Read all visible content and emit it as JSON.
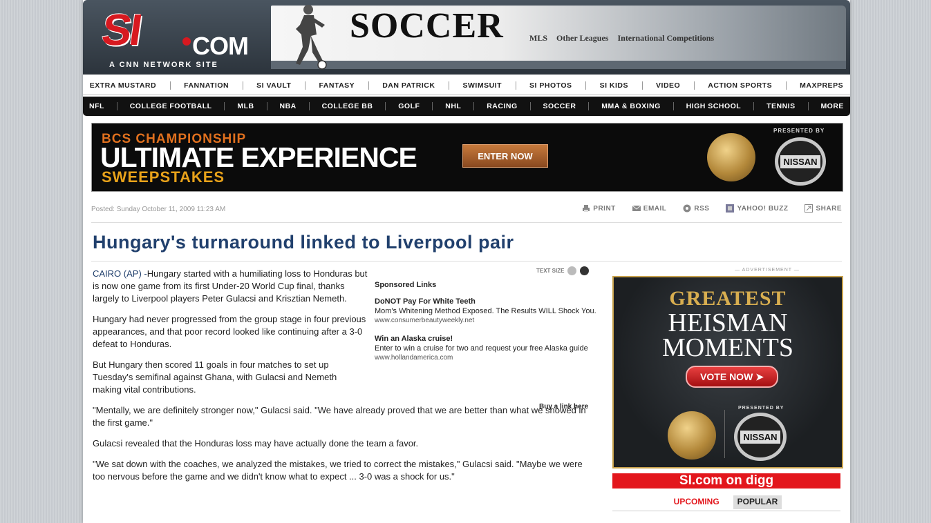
{
  "header": {
    "logo_si": "SI",
    "logo_com": "COM",
    "logo_tagline": "A CNN NETWORK SITE",
    "section_title": "SOCCER",
    "section_links": [
      "MLS",
      "Other Leagues",
      "International Competitions"
    ]
  },
  "nav_top": [
    "EXTRA MUSTARD",
    "FANNATION",
    "SI VAULT",
    "FANTASY",
    "DAN PATRICK",
    "SWIMSUIT",
    "SI PHOTOS",
    "SI KIDS",
    "VIDEO",
    "ACTION SPORTS",
    "MAXPREPS"
  ],
  "nav_main": [
    "NFL",
    "COLLEGE FOOTBALL",
    "MLB",
    "NBA",
    "COLLEGE BB",
    "GOLF",
    "NHL",
    "RACING",
    "SOCCER",
    "MMA & BOXING",
    "HIGH SCHOOL",
    "TENNIS",
    "MORE"
  ],
  "promo": {
    "line1": "BCS CHAMPIONSHIP",
    "line2": "ULTIMATE EXPERIENCE",
    "line3": "SWEEPSTAKES",
    "button": "ENTER NOW",
    "presented_by": "PRESENTED BY",
    "sponsor": "NISSAN"
  },
  "article_meta": {
    "posted": "Posted: Sunday October 11, 2009 11:23 AM",
    "tools": [
      "PRINT",
      "EMAIL",
      "RSS",
      "YAHOO! BUZZ",
      "SHARE"
    ],
    "text_size_label": "TEXT SIZE"
  },
  "headline": "Hungary's turnaround linked to Liverpool pair",
  "article": {
    "dateline": "CAIRO (AP) -",
    "p1": "Hungary started with a humiliating loss to Honduras but is now one game from its first Under-20 World Cup final, thanks largely to Liverpool players Peter Gulacsi and Krisztian Nemeth.",
    "p2": "Hungary had never progressed from the group stage in four previous appearances, and that poor record looked like continuing after a 3-0 defeat to Honduras.",
    "p3": "But Hungary then scored 11 goals in four matches to set up Tuesday's semifinal against Ghana, with Gulacsi and Nemeth making vital contributions.",
    "p4": "\"Mentally, we are definitely stronger now,\" Gulacsi said. \"We have already proved that we are better than what we showed in the first game.\"",
    "p5": "Gulacsi revealed that the Honduras loss may have actually done the team a favor.",
    "p6": "\"We sat down with the coaches, we analyzed the mistakes, we tried to correct the mistakes,\" Gulacsi said. \"Maybe we were too nervous before the game and we didn't know what to expect ... 3-0 was a shock for us.\""
  },
  "sponsored": {
    "heading": "Sponsored Links",
    "links": [
      {
        "title": "DoNOT Pay For White Teeth",
        "desc": "Mom's Whitening Method Exposed. The Results WILL Shock You.",
        "url": "www.consumerbeautyweekly.net"
      },
      {
        "title": "Win an Alaska cruise!",
        "desc": "Enter to win a cruise for two and request your free Alaska guide",
        "url": "www.hollandamerica.com"
      }
    ],
    "buy_link": "Buy a link here"
  },
  "sidebar": {
    "ad_label": "ADVERTISEMENT",
    "heisman_line1": "GREATEST",
    "heisman_line2": "HEISMAN",
    "heisman_line3": "MOMENTS",
    "vote_button": "VOTE NOW",
    "presented_by": "PRESENTED BY",
    "sponsor": "NISSAN",
    "digg_title": "SI.com on digg",
    "digg_tabs": [
      "UPCOMING",
      "POPULAR"
    ]
  },
  "colors": {
    "accent_red": "#d71920",
    "headline_blue": "#21406d",
    "digg_red": "#e3161c",
    "promo_orange": "#e0701e",
    "heisman_gold": "#d8ae50"
  }
}
